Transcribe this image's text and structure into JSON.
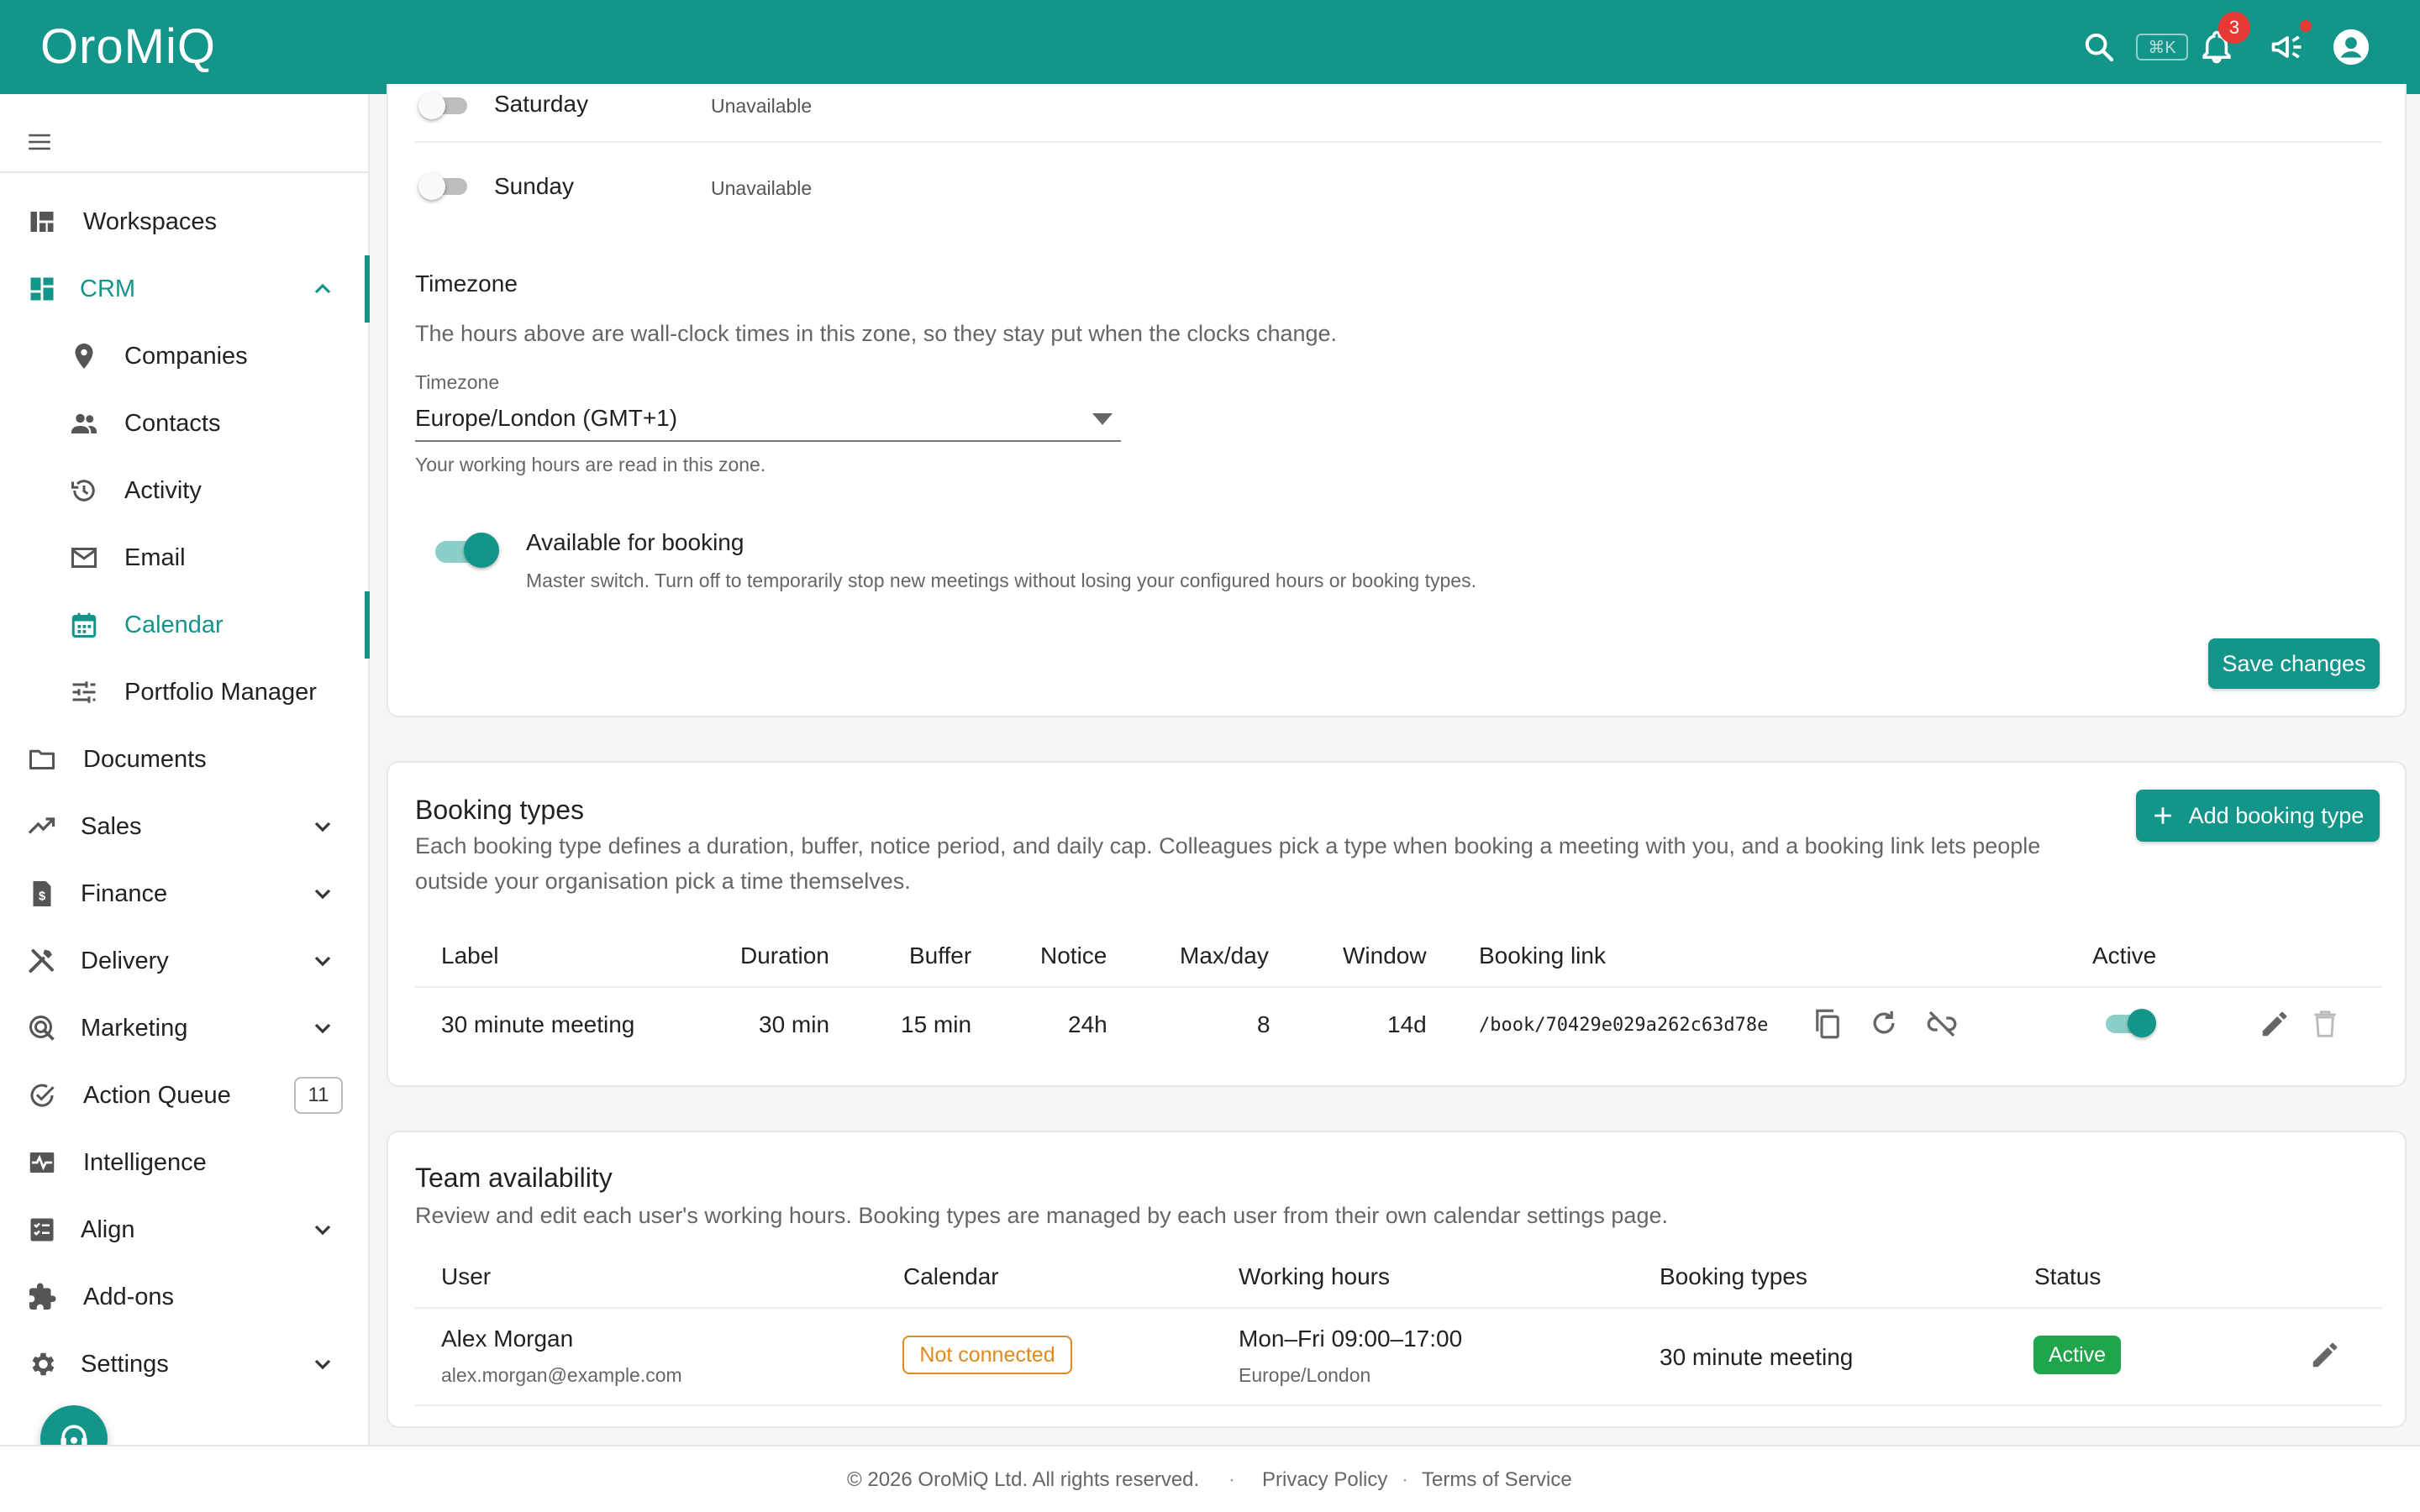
{
  "app": {
    "logo": "OroMiQ",
    "shortcut": "⌘K",
    "notification_count": "3"
  },
  "sidebar": {
    "items": [
      {
        "label": "Workspaces",
        "icon": "dashboard-icon"
      },
      {
        "label": "CRM",
        "icon": "crm-grid-icon"
      },
      {
        "label": "Companies",
        "icon": "location-pin-icon"
      },
      {
        "label": "Contacts",
        "icon": "people-icon"
      },
      {
        "label": "Activity",
        "icon": "history-icon"
      },
      {
        "label": "Email",
        "icon": "mail-icon"
      },
      {
        "label": "Calendar",
        "icon": "calendar-icon"
      },
      {
        "label": "Portfolio Manager",
        "icon": "tune-icon"
      },
      {
        "label": "Documents",
        "icon": "folder-icon"
      },
      {
        "label": "Sales",
        "icon": "trending-up-icon"
      },
      {
        "label": "Finance",
        "icon": "invoice-icon"
      },
      {
        "label": "Delivery",
        "icon": "tools-icon"
      },
      {
        "label": "Marketing",
        "icon": "target-icon"
      },
      {
        "label": "Action Queue",
        "icon": "check-circle-icon"
      },
      {
        "label": "Intelligence",
        "icon": "monitor-heart-icon"
      },
      {
        "label": "Align",
        "icon": "checklist-icon"
      },
      {
        "label": "Add-ons",
        "icon": "puzzle-icon"
      },
      {
        "label": "Settings",
        "icon": "gear-icon"
      }
    ],
    "action_queue_count": "11"
  },
  "availability": {
    "days": [
      {
        "day": "Saturday",
        "status": "Unavailable"
      },
      {
        "day": "Sunday",
        "status": "Unavailable"
      }
    ],
    "timezone_heading": "Timezone",
    "timezone_desc": "The hours above are wall-clock times in this zone, so they stay put when the clocks change.",
    "timezone_label": "Timezone",
    "timezone_value": "Europe/London (GMT+1)",
    "timezone_helper": "Your working hours are read in this zone.",
    "booking_title": "Available for booking",
    "booking_desc": "Master switch. Turn off to temporarily stop new meetings without losing your configured hours or booking types.",
    "save_label": "Save changes"
  },
  "booking_types": {
    "title": "Booking types",
    "desc_line1": "Each booking type defines a duration, buffer, notice period, and daily cap. Colleagues pick a type when booking a meeting with you, and a booking link lets people",
    "desc_line2": "outside your organisation pick a time themselves.",
    "add_label": "Add booking type",
    "columns": [
      "Label",
      "Duration",
      "Buffer",
      "Notice",
      "Max/day",
      "Window",
      "Booking link",
      "Active"
    ],
    "rows": [
      {
        "label": "30 minute meeting",
        "duration": "30 min",
        "buffer": "15 min",
        "notice": "24h",
        "max_day": "8",
        "window": "14d",
        "link": "/book/70429e029a262c63d78e"
      }
    ]
  },
  "team": {
    "title": "Team availability",
    "desc": "Review and edit each user's working hours. Booking types are managed by each user from their own calendar settings page.",
    "columns": [
      "User",
      "Calendar",
      "Working hours",
      "Booking types",
      "Status"
    ],
    "rows": [
      {
        "name": "Alex Morgan",
        "email": "alex.morgan@example.com",
        "calendar": "Not connected",
        "hours": "Mon–Fri 09:00–17:00",
        "tz": "Europe/London",
        "booking_types": "30 minute meeting",
        "status": "Active"
      }
    ]
  },
  "footer": {
    "copyright": "© 2026 OroMiQ Ltd. All rights reserved.",
    "sep1": "·",
    "privacy": "Privacy Policy",
    "sep2": "·",
    "terms": "Terms of Service"
  },
  "colors": {
    "brand": "#14958a",
    "warning": "#e08a1e",
    "success": "#1fa54a",
    "danger": "#e53935"
  }
}
